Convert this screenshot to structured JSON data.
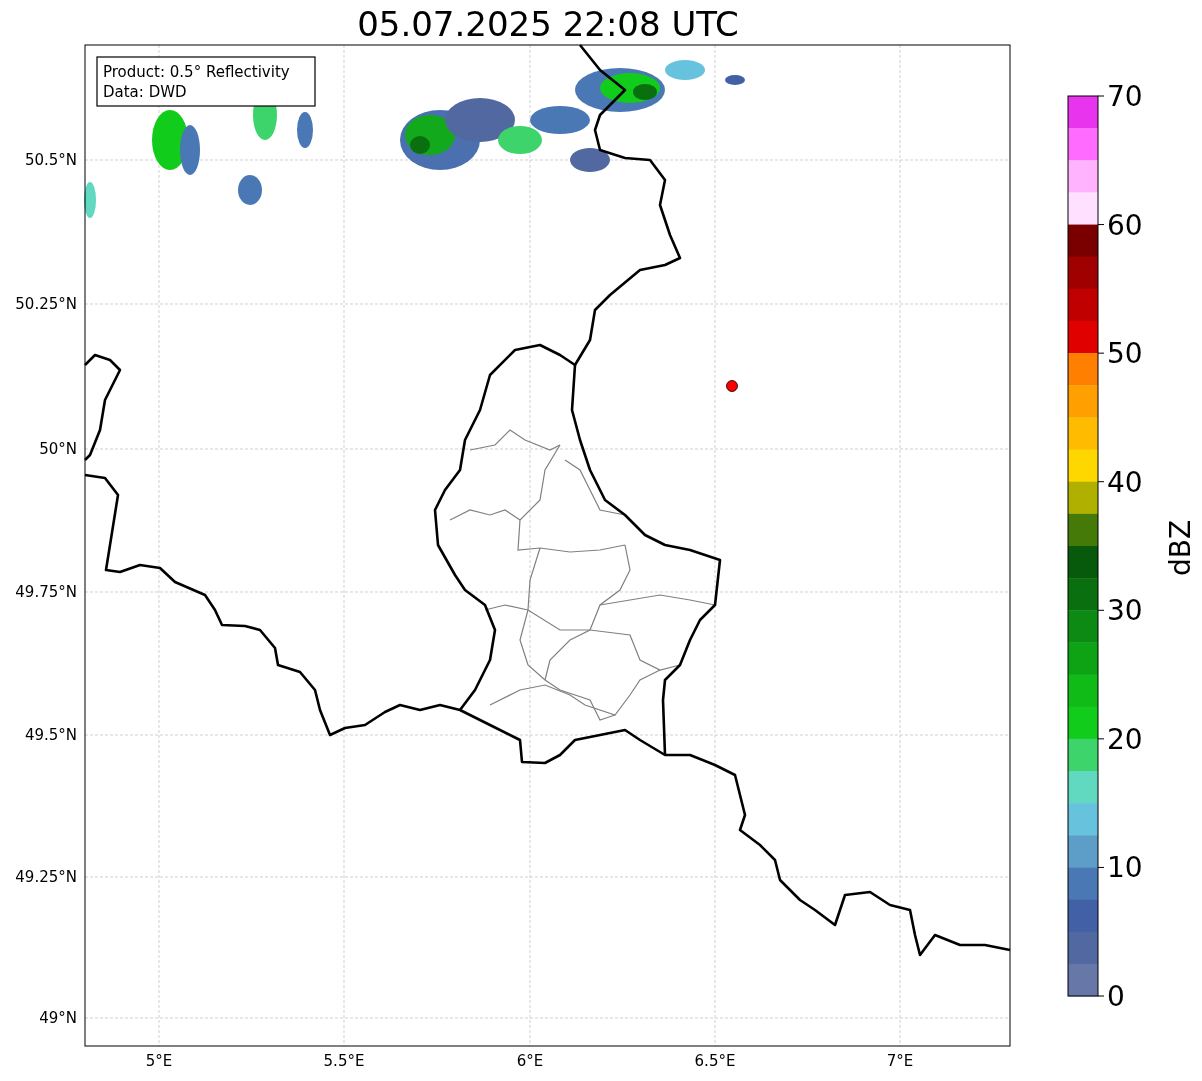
{
  "title": "05.07.2025 22:08 UTC",
  "legend": {
    "lines": [
      "Product: 0.5° Reflectivity",
      "Data: DWD"
    ]
  },
  "y_ticks": [
    "50.5°N",
    "50.25°N",
    "50°N",
    "49.75°N",
    "49.5°N",
    "49.25°N",
    "49°N"
  ],
  "x_ticks": [
    "5°E",
    "5.5°E",
    "6°E",
    "6.5°E",
    "7°E"
  ],
  "colorbar": {
    "label": "dBZ",
    "ticks": [
      "70",
      "60",
      "50",
      "40",
      "30",
      "20",
      "10",
      "0"
    ],
    "bins": [
      {
        "color": "#e934ee"
      },
      {
        "color": "#ff6bff"
      },
      {
        "color": "#ffb3ff"
      },
      {
        "color": "#ffe0ff"
      },
      {
        "color": "#7a0000"
      },
      {
        "color": "#a00000"
      },
      {
        "color": "#c00000"
      },
      {
        "color": "#e00000"
      },
      {
        "color": "#ff7f00"
      },
      {
        "color": "#ff9f00"
      },
      {
        "color": "#ffbb00"
      },
      {
        "color": "#ffd700"
      },
      {
        "color": "#b0b000"
      },
      {
        "color": "#457a08"
      },
      {
        "color": "#07590b"
      },
      {
        "color": "#0a700f"
      },
      {
        "color": "#0c8a14"
      },
      {
        "color": "#0ea315"
      },
      {
        "color": "#10bb18"
      },
      {
        "color": "#12cc1c"
      },
      {
        "color": "#3dd46b"
      },
      {
        "color": "#60d9c0"
      },
      {
        "color": "#66c2dd"
      },
      {
        "color": "#5c9ec8"
      },
      {
        "color": "#4a78b4"
      },
      {
        "color": "#4260a5"
      },
      {
        "color": "#5268a0"
      },
      {
        "color": "#6677a8"
      }
    ]
  }
}
